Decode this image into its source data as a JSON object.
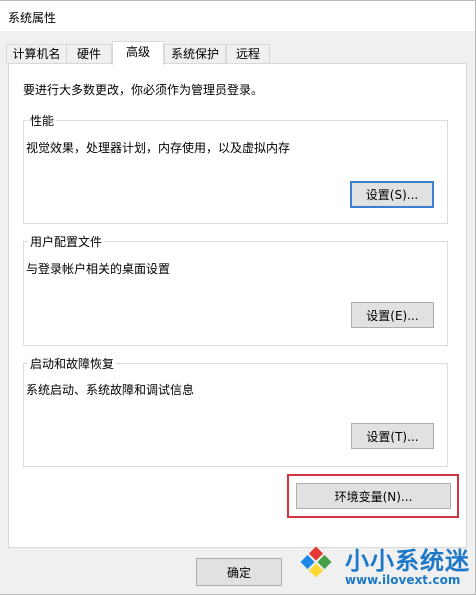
{
  "window": {
    "title": "系统属性"
  },
  "tabs": [
    {
      "label": "计算机名"
    },
    {
      "label": "硬件"
    },
    {
      "label": "高级",
      "active": true
    },
    {
      "label": "系统保护"
    },
    {
      "label": "远程"
    }
  ],
  "note": "要进行大多数更改，你必须作为管理员登录。",
  "groups": {
    "performance": {
      "legend": "性能",
      "desc": "视觉效果，处理器计划，内存使用，以及虚拟内存",
      "button": "设置(S)..."
    },
    "profile": {
      "legend": "用户配置文件",
      "desc": "与登录帐户相关的桌面设置",
      "button": "设置(E)..."
    },
    "recovery": {
      "legend": "启动和故障恢复",
      "desc": "系统启动、系统故障和调试信息",
      "button": "设置(T)..."
    }
  },
  "env_button": "环境变量(N)...",
  "ok_button": "确定",
  "watermark": {
    "title": "小小系统迷",
    "url": "www.ilovext.com"
  },
  "colors": {
    "focus_border": "#3c7fd0",
    "highlight_box": "#d2353f",
    "watermark_blue": "#1d79c7"
  }
}
